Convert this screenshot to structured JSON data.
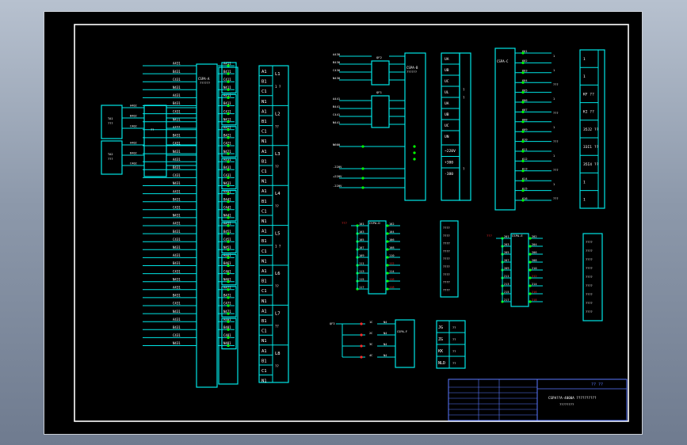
{
  "colors": {
    "frame": "#ffffff",
    "line": "#00e5e5",
    "text": "#ffffff",
    "text_cyan": "#00e5e5",
    "node": "#00ff00",
    "alarm": "#ff2a2a",
    "title_block": "#5a78ff"
  },
  "panel_a": {
    "rows": [
      {
        "l": "A431",
        "r": "A411"
      },
      {
        "l": "B431",
        "r": "B411"
      },
      {
        "l": "C431",
        "r": "C411"
      },
      {
        "l": "N431",
        "r": "N411"
      },
      {
        "l": "A431",
        "r": "A411"
      },
      {
        "l": "B431",
        "r": "B411"
      },
      {
        "l": "C431",
        "r": "C411"
      },
      {
        "l": "N431",
        "r": "N411"
      },
      {
        "l": "A431",
        "r": "A421"
      },
      {
        "l": "B431",
        "r": "B421"
      },
      {
        "l": "C431",
        "r": "C421"
      },
      {
        "l": "N431",
        "r": "N421"
      },
      {
        "l": "A431",
        "r": "A431"
      },
      {
        "l": "B431",
        "r": "B431"
      },
      {
        "l": "C431",
        "r": "C431"
      },
      {
        "l": "N431",
        "r": "N431"
      },
      {
        "l": "A431",
        "r": "A441"
      },
      {
        "l": "B431",
        "r": "B441"
      },
      {
        "l": "C431",
        "r": "C441"
      },
      {
        "l": "N431",
        "r": "N441"
      },
      {
        "l": "A431",
        "r": "A451"
      },
      {
        "l": "B431",
        "r": "B451"
      },
      {
        "l": "C431",
        "r": "C451"
      },
      {
        "l": "N431",
        "r": "N451"
      },
      {
        "l": "A431",
        "r": "A461"
      },
      {
        "l": "B431",
        "r": "B461"
      },
      {
        "l": "C431",
        "r": "C461"
      },
      {
        "l": "N431",
        "r": "N461"
      },
      {
        "l": "A431",
        "r": "A471"
      },
      {
        "l": "B431",
        "r": "B471"
      },
      {
        "l": "C431",
        "r": "C471"
      },
      {
        "l": "N431",
        "r": "N471"
      },
      {
        "l": "A431",
        "r": "A481"
      },
      {
        "l": "B431",
        "r": "B481"
      },
      {
        "l": "C431",
        "r": "C481"
      },
      {
        "l": "N431",
        "r": "N481"
      }
    ],
    "module_label": "CSPA-A",
    "module_sub": "??????",
    "ct_boxes": [
      {
        "a": "TA1",
        "b": "???"
      },
      {
        "a": "TA2",
        "b": "???"
      }
    ],
    "ct_rows": [
      "A402",
      "B402",
      "C402",
      "A402",
      "B402",
      "C402"
    ],
    "ct_mid_label": "??"
  },
  "panel_b": {
    "groups": [
      {
        "phase": "L1",
        "note": "1 ?"
      },
      {
        "phase": "L2",
        "note": "??"
      },
      {
        "phase": "L3",
        "note": "??"
      },
      {
        "phase": "L4",
        "note": "??"
      },
      {
        "phase": "L5",
        "note": "1 ?"
      },
      {
        "phase": "L6",
        "note": "??"
      },
      {
        "phase": "L7",
        "note": "??"
      },
      {
        "phase": "L8",
        "note": "??"
      }
    ],
    "cells": [
      "A1",
      "B1",
      "C1",
      "N1"
    ]
  },
  "panel_c": {
    "qf1": "QF1",
    "qf2": "QF2",
    "inputs": [
      "A430",
      "B430",
      "C430",
      "N430",
      "A441",
      "B441",
      "C441",
      "N441"
    ],
    "extra": [
      "N600",
      "-220V",
      "+220V",
      "-220V"
    ],
    "module_label": "CSPA-B",
    "module_sub": "??????"
  },
  "panel_d": {
    "rows": [
      "UA",
      "UB",
      "UC",
      "UL",
      "UA",
      "UB",
      "UC",
      "UN",
      "~220V",
      "+380",
      "-380"
    ]
  },
  "panel_e": {
    "module_label": "CSPA-C",
    "outputs": [
      "601",
      "602",
      "603",
      "604",
      "605",
      "606",
      "607",
      "608",
      "609",
      "610",
      "611",
      "612",
      "613",
      "614",
      "615",
      "616"
    ],
    "right_tags": [
      "1",
      "1",
      "???",
      "1",
      "???",
      "1",
      "???",
      "1",
      "???",
      "1",
      "???"
    ]
  },
  "panel_f": {
    "rows": [
      "1",
      "1",
      "KF ??",
      "KI ??",
      "35J2 ??",
      "33I1 ??",
      "35I4 ??",
      "1",
      "1"
    ]
  },
  "panel_g1": {
    "module_label": "CSPA-D",
    "in_tag": "???",
    "left": [
      "101",
      "103",
      "105",
      "107",
      "109",
      "111",
      "113",
      "115",
      "117"
    ],
    "right": [
      "102",
      "104",
      "106",
      "108",
      "110",
      "112",
      "114",
      "116",
      "118"
    ]
  },
  "panel_g2": {
    "rows": [
      "????",
      "????",
      "????",
      "????",
      "????",
      "????",
      "????",
      "????",
      "????"
    ]
  },
  "panel_h1": {
    "module_label": "CSPA-E",
    "in_tag": "???",
    "left": [
      "201",
      "203",
      "205",
      "207",
      "209",
      "211",
      "213",
      "215",
      "217"
    ],
    "right": [
      "202",
      "204",
      "206",
      "208",
      "210",
      "212",
      "214",
      "216",
      "218"
    ]
  },
  "panel_h2": {
    "rows": [
      "????",
      "????",
      "????",
      "????",
      "????",
      "????",
      "????",
      "????",
      "????"
    ]
  },
  "panel_i": {
    "module_label": "CSPA-F",
    "inputs": [
      "1C",
      "2C",
      "3C",
      "4C"
    ],
    "outputs": [
      "N4",
      "N4",
      "N4",
      "N4"
    ],
    "src": "QF3"
  },
  "panel_j": {
    "rows": [
      {
        "a": "JG",
        "b": "??"
      },
      {
        "a": "ZG",
        "b": "??"
      },
      {
        "a": "KK",
        "b": "??"
      },
      {
        "a": "NLD",
        "b": "??"
      }
    ]
  },
  "title_block": {
    "top_right": "?? ??",
    "drawing_title": "CSPA??A-4000A ??????????",
    "drawing_sub": "????????"
  }
}
